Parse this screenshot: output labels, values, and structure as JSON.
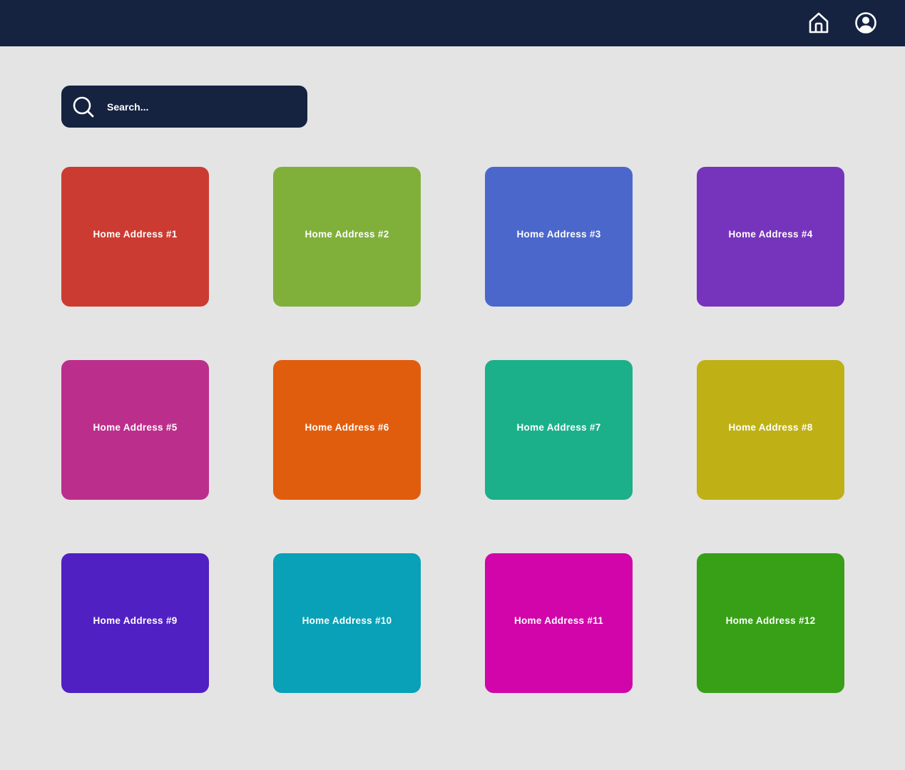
{
  "header": {
    "home_icon": "home-icon",
    "profile_icon": "user-circle-icon",
    "background": "#152240"
  },
  "search": {
    "icon": "search-icon",
    "placeholder": "Search...",
    "value": ""
  },
  "addresses": [
    {
      "label": "Home Address #1",
      "color": "#cc3b31"
    },
    {
      "label": "Home Address #2",
      "color": "#80b03a"
    },
    {
      "label": "Home Address #3",
      "color": "#4b67cc"
    },
    {
      "label": "Home Address #4",
      "color": "#7634bc"
    },
    {
      "label": "Home Address #5",
      "color": "#bc2e8c"
    },
    {
      "label": "Home Address #6",
      "color": "#e15d0e"
    },
    {
      "label": "Home Address #7",
      "color": "#1bb08a"
    },
    {
      "label": "Home Address #8",
      "color": "#bfb115"
    },
    {
      "label": "Home Address #9",
      "color": "#5020c2"
    },
    {
      "label": "Home Address #10",
      "color": "#08a1b8"
    },
    {
      "label": "Home Address #11",
      "color": "#d105a9"
    },
    {
      "label": "Home Address #12",
      "color": "#37a017"
    }
  ]
}
